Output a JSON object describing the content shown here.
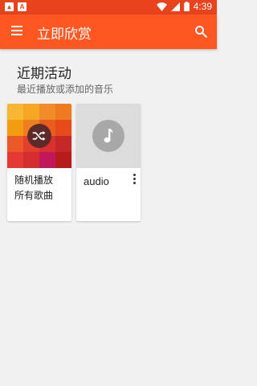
{
  "status_bar": {
    "time": "4:39",
    "notification_icons": [
      "image-icon",
      "text-a-icon"
    ],
    "system_icons": [
      "wifi-icon",
      "signal-icon",
      "battery-icon"
    ]
  },
  "app_bar": {
    "title": "立即欣赏",
    "color": "#ff5722",
    "nav_icon": "menu-icon",
    "action_icon": "search-icon"
  },
  "section": {
    "title": "近期活动",
    "subtitle": "最近播放或添加的音乐"
  },
  "cards": [
    {
      "line1": "随机播放",
      "line2": "所有歌曲",
      "icon": "shuffle-icon",
      "art_colors": [
        "#f7b733",
        "#f5a623",
        "#f28c28",
        "#ee7b1f",
        "#f39c12",
        "#ef7d22",
        "#e85d1f",
        "#e64a19",
        "#ea5a28",
        "#e43f2a",
        "#d9312f",
        "#c62828",
        "#e53935",
        "#d32f2f",
        "#c2185b",
        "#b71c1c"
      ]
    },
    {
      "title": "audio",
      "icon": "music-note-icon",
      "overflow_icon": "more-vert-icon"
    }
  ]
}
